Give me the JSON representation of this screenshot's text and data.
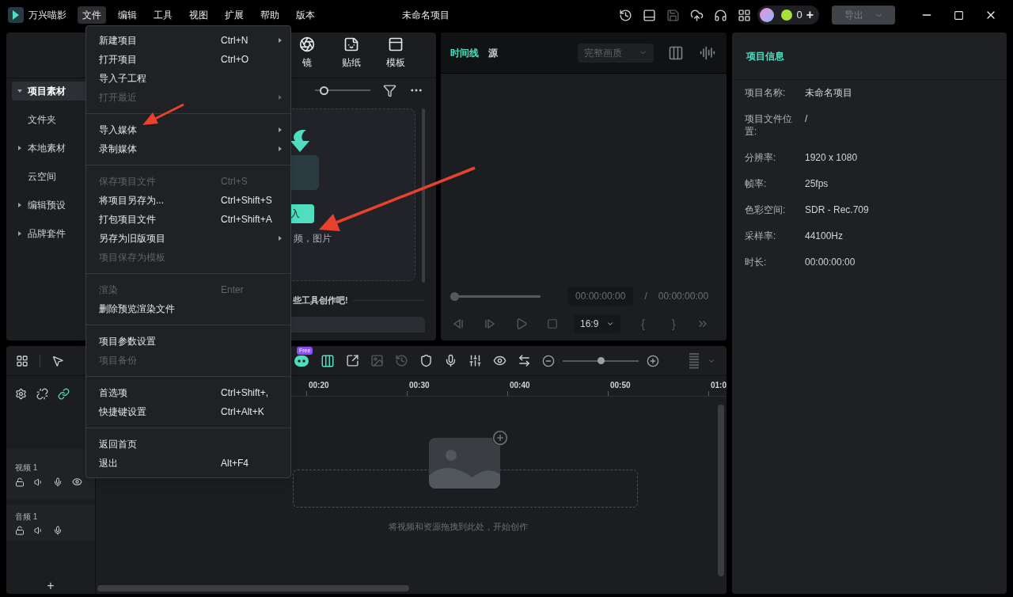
{
  "app": {
    "name": "万兴喵影"
  },
  "menubar": [
    {
      "label": "文件",
      "selected": true
    },
    {
      "label": "编辑",
      "selected": false
    },
    {
      "label": "工具",
      "selected": false
    },
    {
      "label": "视图",
      "selected": false
    },
    {
      "label": "扩展",
      "selected": false
    },
    {
      "label": "帮助",
      "selected": false
    },
    {
      "label": "版本",
      "selected": false
    }
  ],
  "window": {
    "title": "未命名项目"
  },
  "account": {
    "credits": "0",
    "add": "+"
  },
  "export_button": {
    "label": "导出",
    "disabled": true
  },
  "file_menu": {
    "sections": [
      [
        {
          "label": "新建项目",
          "shortcut": "Ctrl+N",
          "submenu": true,
          "disabled": false
        },
        {
          "label": "打开项目",
          "shortcut": "Ctrl+O",
          "submenu": false,
          "disabled": false
        },
        {
          "label": "导入子工程",
          "submenu": false,
          "disabled": false
        },
        {
          "label": "打开最近",
          "submenu": true,
          "disabled": true
        }
      ],
      [
        {
          "label": "导入媒体",
          "submenu": true,
          "disabled": false
        },
        {
          "label": "录制媒体",
          "submenu": true,
          "disabled": false
        }
      ],
      [
        {
          "label": "保存项目文件",
          "shortcut": "Ctrl+S",
          "submenu": false,
          "disabled": true
        },
        {
          "label": "将项目另存为...",
          "shortcut": "Ctrl+Shift+S",
          "submenu": false,
          "disabled": false
        },
        {
          "label": "打包项目文件",
          "shortcut": "Ctrl+Shift+A",
          "submenu": false,
          "disabled": false
        },
        {
          "label": "另存为旧版项目",
          "submenu": true,
          "disabled": false
        },
        {
          "label": "项目保存为模板",
          "submenu": false,
          "disabled": true
        }
      ],
      [
        {
          "label": "渲染",
          "shortcut": "Enter",
          "submenu": false,
          "disabled": true
        },
        {
          "label": "删除预览渲染文件",
          "submenu": false,
          "disabled": false
        }
      ],
      [
        {
          "label": "项目参数设置",
          "submenu": false,
          "disabled": false
        },
        {
          "label": "项目备份",
          "submenu": false,
          "disabled": true
        }
      ],
      [
        {
          "label": "首选项",
          "shortcut": "Ctrl+Shift+,",
          "submenu": false,
          "disabled": false
        },
        {
          "label": "快捷键设置",
          "shortcut": "Ctrl+Alt+K",
          "submenu": false,
          "disabled": false
        }
      ],
      [
        {
          "label": "返回首页",
          "submenu": false,
          "disabled": false
        },
        {
          "label": "退出",
          "shortcut": "Alt+F4",
          "submenu": false,
          "disabled": false
        }
      ]
    ]
  },
  "media_tabs": [
    {
      "label": "镜"
    },
    {
      "label": "贴纸"
    },
    {
      "label": "模板"
    }
  ],
  "sidebar": [
    {
      "label": "项目素材",
      "selected": true,
      "expanded": true,
      "children": [
        {
          "label": "文件夹",
          "selected": false
        }
      ]
    },
    {
      "label": "本地素材",
      "selected": false,
      "expanded": false
    },
    {
      "label": "云空间",
      "selected": false
    },
    {
      "label": "编辑预设",
      "selected": false,
      "expanded": false
    },
    {
      "label": "品牌套件",
      "selected": false,
      "expanded": false
    }
  ],
  "media_zoom": {
    "level": 0.15
  },
  "import_panel": {
    "button": "入",
    "hint": "频，图片",
    "section_title": "些工具创作吧!"
  },
  "preview": {
    "tabs": [
      {
        "label": "时间线",
        "selected": true
      },
      {
        "label": "源",
        "selected": false
      }
    ],
    "quality": "完整画质",
    "progress": {
      "level": 0
    },
    "current_time": "00:00:00:00",
    "separator": "/",
    "total_time": "00:00:00:00",
    "aspect_ratio": "16:9",
    "mark_in": "{",
    "mark_out": "}"
  },
  "project_info": {
    "title": "项目信息",
    "rows": [
      {
        "label": "项目名称:",
        "value": "未命名项目"
      },
      {
        "label": "项目文件位置:",
        "value": "/"
      },
      {
        "label": "分辨率:",
        "value": "1920 x 1080"
      },
      {
        "label": "帧率:",
        "value": "25fps"
      },
      {
        "label": "色彩空间:",
        "value": "SDR - Rec.709"
      },
      {
        "label": "采样率:",
        "value": "44100Hz"
      },
      {
        "label": "时长:",
        "value": "00:00:00:00"
      }
    ]
  },
  "timeline": {
    "free_badge": "Free",
    "zoom": {
      "level": 0.5
    },
    "ruler": [
      "00:20",
      "00:30",
      "00:40",
      "00:50",
      "01:0"
    ],
    "tracks": [
      {
        "name": "视频 1",
        "kind": "video"
      },
      {
        "name": "音频 1",
        "kind": "audio"
      }
    ],
    "drop_hint": "将视频和资源拖拽到此处，开始创作",
    "add_track": "+"
  }
}
